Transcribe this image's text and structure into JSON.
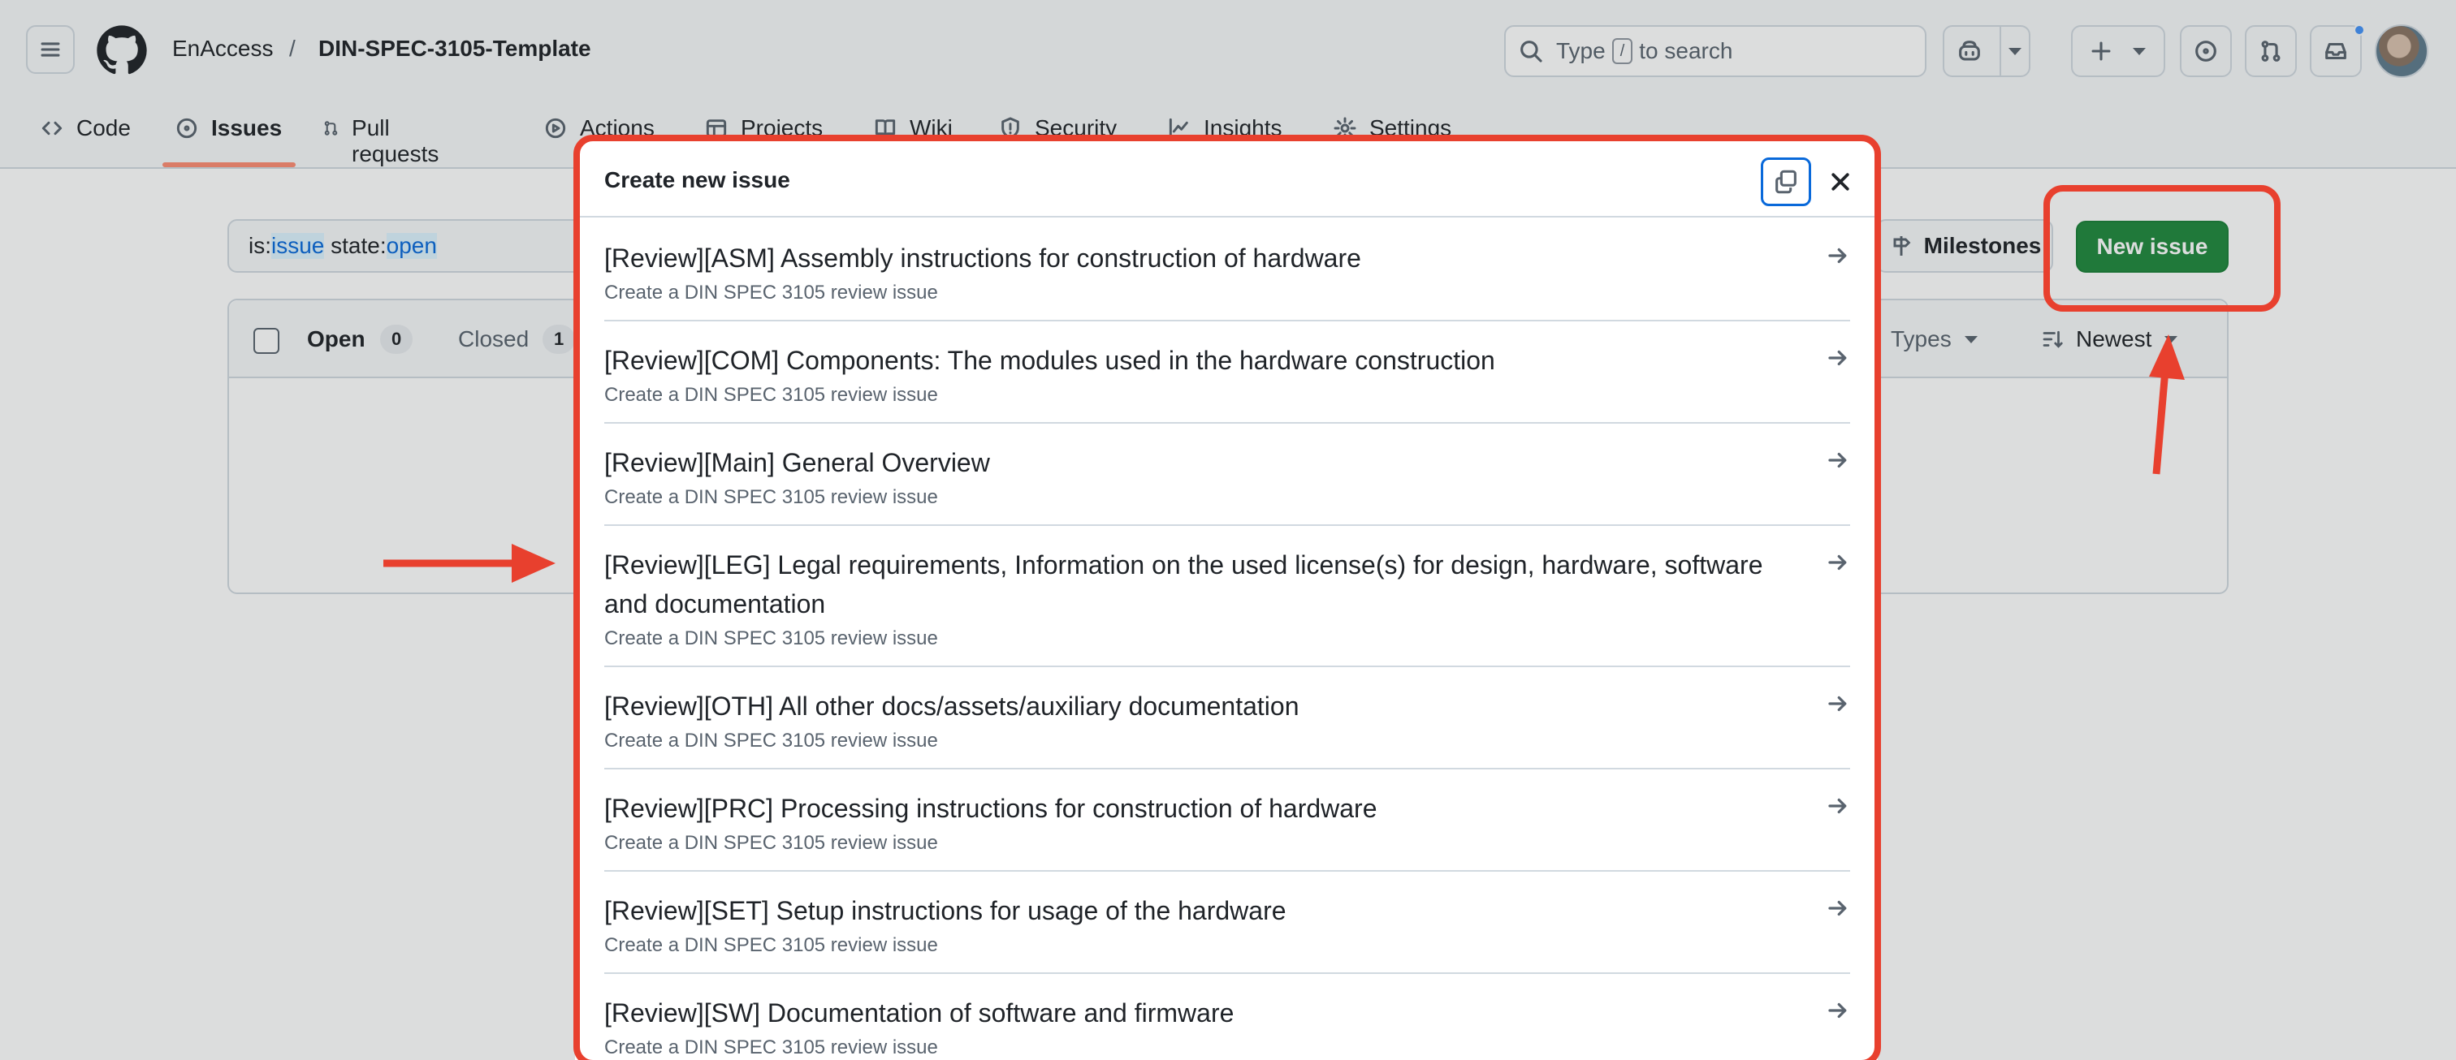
{
  "header": {
    "owner": "EnAccess",
    "separator": "/",
    "repo": "DIN-SPEC-3105-Template",
    "search": {
      "prefix": "Type",
      "key": "/",
      "suffix": "to search"
    }
  },
  "tabs": [
    {
      "label": "Code"
    },
    {
      "label": "Issues"
    },
    {
      "label": "Pull requests"
    },
    {
      "label": "Actions"
    },
    {
      "label": "Projects"
    },
    {
      "label": "Wiki"
    },
    {
      "label": "Security"
    },
    {
      "label": "Insights"
    },
    {
      "label": "Settings"
    }
  ],
  "issues_page": {
    "filter": {
      "p1": "is:",
      "v1": "issue",
      "p2": " state:",
      "v2": "open"
    },
    "milestones_label": "Milestones",
    "new_issue_label": "New issue",
    "open_label": "Open",
    "open_count": "0",
    "closed_label": "Closed",
    "closed_count": "1",
    "types_label": "Types",
    "sort_label": "Newest"
  },
  "dialog": {
    "title": "Create new issue",
    "templates": [
      {
        "name": "[Review][ASM] Assembly instructions for construction of hardware",
        "description": "Create a DIN SPEC 3105 review issue"
      },
      {
        "name": "[Review][COM] Components: The modules used in the hardware construction",
        "description": "Create a DIN SPEC 3105 review issue"
      },
      {
        "name": "[Review][Main] General Overview",
        "description": "Create a DIN SPEC 3105 review issue"
      },
      {
        "name": "[Review][LEG] Legal requirements, Information on the used license(s) for design, hardware, software and documentation",
        "description": "Create a DIN SPEC 3105 review issue"
      },
      {
        "name": "[Review][OTH] All other docs/assets/auxiliary documentation",
        "description": "Create a DIN SPEC 3105 review issue"
      },
      {
        "name": "[Review][PRC] Processing instructions for construction of hardware",
        "description": "Create a DIN SPEC 3105 review issue"
      },
      {
        "name": "[Review][SET] Setup instructions for usage of the hardware",
        "description": "Create a DIN SPEC 3105 review issue"
      },
      {
        "name": "[Review][SW] Documentation of software and firmware",
        "description": "Create a DIN SPEC 3105 review issue"
      }
    ]
  },
  "colors": {
    "annotation": "#e8402e",
    "primary_button": "#1f883d",
    "focus_ring": "#0969da",
    "active_tab_underline": "#fd8c73"
  }
}
